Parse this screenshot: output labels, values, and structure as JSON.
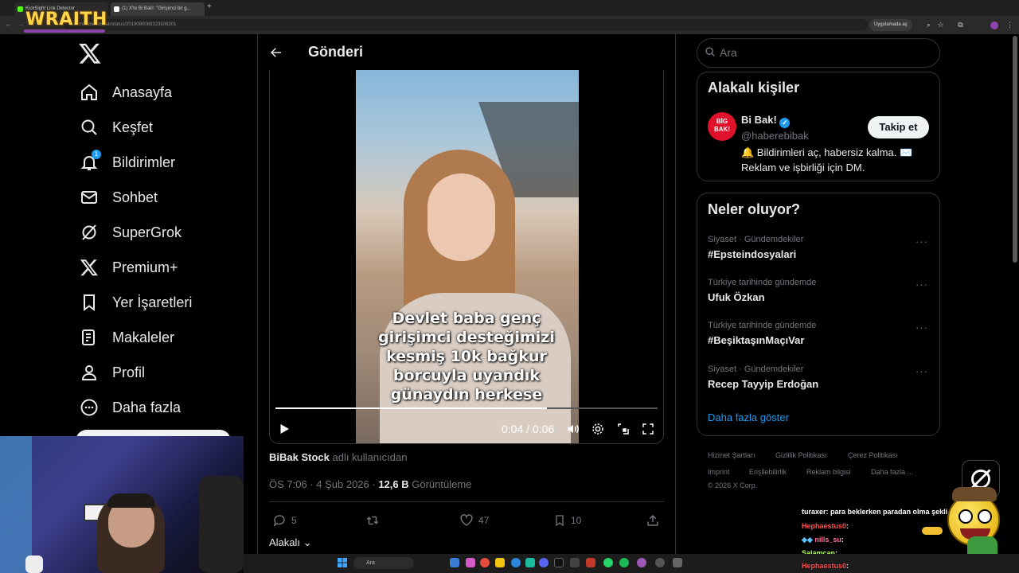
{
  "browser": {
    "tabs": [
      {
        "title": "KickSight Link Detector"
      },
      {
        "title": "(1) X'te Bi Bak!: \"Girişimci bir g..."
      }
    ],
    "url": "x.com/haberebibak/status/2019080088323506301",
    "app_open_label": "Uygulamada aç",
    "overlay_brand": "WRAITH"
  },
  "sidebar": {
    "items": [
      {
        "label": "Anasayfa",
        "icon": "home-icon"
      },
      {
        "label": "Keşfet",
        "icon": "search-icon"
      },
      {
        "label": "Bildirimler",
        "icon": "bell-icon",
        "badge": "1"
      },
      {
        "label": "Sohbet",
        "icon": "mail-icon"
      },
      {
        "label": "SuperGrok",
        "icon": "grok-icon"
      },
      {
        "label": "Premium+",
        "icon": "x-icon"
      },
      {
        "label": "Yer İşaretleri",
        "icon": "bookmark-icon"
      },
      {
        "label": "Makaleler",
        "icon": "article-icon"
      },
      {
        "label": "Profil",
        "icon": "person-icon"
      },
      {
        "label": "Daha fazla",
        "icon": "more-icon"
      }
    ]
  },
  "post": {
    "header_title": "Gönderi",
    "video_caption": "Devlet baba genç girişimci desteğimizi kesmiş 10k bağkur borcuyla uyandık günaydın herkese",
    "video_time": "0:04 / 0:06",
    "progress": 0.71,
    "from_user": "BiBak Stock",
    "from_suffix": " adlı kullanıcıdan",
    "timestamp": "ÖS 7:06 · 4 Şub 2026 · ",
    "views": "12,6 B",
    "views_label": " Görüntüleme",
    "replies": "5",
    "likes": "47",
    "bookmarks": "10",
    "related": "Alakalı"
  },
  "right": {
    "search_placeholder": "Ara",
    "related_people": {
      "title": "Alakalı kişiler",
      "name": "Bi Bak!",
      "handle": "@haberebibak",
      "bio": "🔔 Bildirimleri aç, habersiz kalma. ✉️ Reklam ve işbirliği için DM.",
      "follow_label": "Takip et",
      "avatar_text": "BİG BAK!"
    },
    "trends": {
      "title": "Neler oluyor?",
      "items": [
        {
          "context": "Siyaset · Gündemdekiler",
          "name": "#Epsteindosyalari"
        },
        {
          "context": "Türkiye tarihinde gündemde",
          "name": "Ufuk Özkan"
        },
        {
          "context": "Türkiye tarihinde gündemde",
          "name": "#BeşiktaşınMaçıVar"
        },
        {
          "context": "Siyaset · Gündemdekiler",
          "name": "Recep Tayyip Erdoğan"
        }
      ],
      "show_more": "Daha fazla göster"
    },
    "footer": {
      "links_row1": [
        "Hizmet Şartları",
        "Gizlilik Politikası",
        "Çerez Politikası"
      ],
      "links_row2": [
        "Imprint",
        "Erişilebilirlik",
        "Reklam bilgisi",
        "Daha fazla ..."
      ],
      "copyright": "© 2026 X Corp."
    }
  },
  "chat": [
    {
      "user": "turaxer",
      "msg": ": para beklerken paradan olma şekli",
      "color": "#ffffff"
    },
    {
      "user": "Hephaestus0",
      "msg": ":",
      "color": "#ff4d4d"
    },
    {
      "user": "nills_su",
      "msg": ":",
      "color": "#ff6b9a"
    },
    {
      "user": "Salamcan",
      "msg": ":",
      "color": "#b6ff4d"
    },
    {
      "user": "Hephaestus0",
      "msg": ":",
      "color": "#ff4d4d"
    }
  ],
  "taskbar": {
    "search_placeholder": "Ara"
  }
}
